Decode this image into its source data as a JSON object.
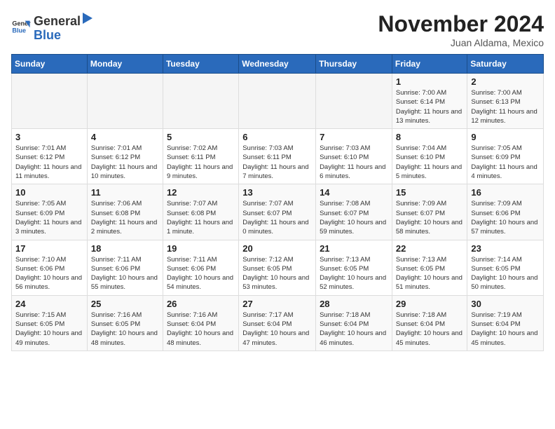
{
  "header": {
    "logo_general": "General",
    "logo_blue": "Blue",
    "month_title": "November 2024",
    "subtitle": "Juan Aldama, Mexico"
  },
  "weekdays": [
    "Sunday",
    "Monday",
    "Tuesday",
    "Wednesday",
    "Thursday",
    "Friday",
    "Saturday"
  ],
  "weeks": [
    [
      {
        "day": "",
        "info": ""
      },
      {
        "day": "",
        "info": ""
      },
      {
        "day": "",
        "info": ""
      },
      {
        "day": "",
        "info": ""
      },
      {
        "day": "",
        "info": ""
      },
      {
        "day": "1",
        "info": "Sunrise: 7:00 AM\nSunset: 6:14 PM\nDaylight: 11 hours and 13 minutes."
      },
      {
        "day": "2",
        "info": "Sunrise: 7:00 AM\nSunset: 6:13 PM\nDaylight: 11 hours and 12 minutes."
      }
    ],
    [
      {
        "day": "3",
        "info": "Sunrise: 7:01 AM\nSunset: 6:12 PM\nDaylight: 11 hours and 11 minutes."
      },
      {
        "day": "4",
        "info": "Sunrise: 7:01 AM\nSunset: 6:12 PM\nDaylight: 11 hours and 10 minutes."
      },
      {
        "day": "5",
        "info": "Sunrise: 7:02 AM\nSunset: 6:11 PM\nDaylight: 11 hours and 9 minutes."
      },
      {
        "day": "6",
        "info": "Sunrise: 7:03 AM\nSunset: 6:11 PM\nDaylight: 11 hours and 7 minutes."
      },
      {
        "day": "7",
        "info": "Sunrise: 7:03 AM\nSunset: 6:10 PM\nDaylight: 11 hours and 6 minutes."
      },
      {
        "day": "8",
        "info": "Sunrise: 7:04 AM\nSunset: 6:10 PM\nDaylight: 11 hours and 5 minutes."
      },
      {
        "day": "9",
        "info": "Sunrise: 7:05 AM\nSunset: 6:09 PM\nDaylight: 11 hours and 4 minutes."
      }
    ],
    [
      {
        "day": "10",
        "info": "Sunrise: 7:05 AM\nSunset: 6:09 PM\nDaylight: 11 hours and 3 minutes."
      },
      {
        "day": "11",
        "info": "Sunrise: 7:06 AM\nSunset: 6:08 PM\nDaylight: 11 hours and 2 minutes."
      },
      {
        "day": "12",
        "info": "Sunrise: 7:07 AM\nSunset: 6:08 PM\nDaylight: 11 hours and 1 minute."
      },
      {
        "day": "13",
        "info": "Sunrise: 7:07 AM\nSunset: 6:07 PM\nDaylight: 11 hours and 0 minutes."
      },
      {
        "day": "14",
        "info": "Sunrise: 7:08 AM\nSunset: 6:07 PM\nDaylight: 10 hours and 59 minutes."
      },
      {
        "day": "15",
        "info": "Sunrise: 7:09 AM\nSunset: 6:07 PM\nDaylight: 10 hours and 58 minutes."
      },
      {
        "day": "16",
        "info": "Sunrise: 7:09 AM\nSunset: 6:06 PM\nDaylight: 10 hours and 57 minutes."
      }
    ],
    [
      {
        "day": "17",
        "info": "Sunrise: 7:10 AM\nSunset: 6:06 PM\nDaylight: 10 hours and 56 minutes."
      },
      {
        "day": "18",
        "info": "Sunrise: 7:11 AM\nSunset: 6:06 PM\nDaylight: 10 hours and 55 minutes."
      },
      {
        "day": "19",
        "info": "Sunrise: 7:11 AM\nSunset: 6:06 PM\nDaylight: 10 hours and 54 minutes."
      },
      {
        "day": "20",
        "info": "Sunrise: 7:12 AM\nSunset: 6:05 PM\nDaylight: 10 hours and 53 minutes."
      },
      {
        "day": "21",
        "info": "Sunrise: 7:13 AM\nSunset: 6:05 PM\nDaylight: 10 hours and 52 minutes."
      },
      {
        "day": "22",
        "info": "Sunrise: 7:13 AM\nSunset: 6:05 PM\nDaylight: 10 hours and 51 minutes."
      },
      {
        "day": "23",
        "info": "Sunrise: 7:14 AM\nSunset: 6:05 PM\nDaylight: 10 hours and 50 minutes."
      }
    ],
    [
      {
        "day": "24",
        "info": "Sunrise: 7:15 AM\nSunset: 6:05 PM\nDaylight: 10 hours and 49 minutes."
      },
      {
        "day": "25",
        "info": "Sunrise: 7:16 AM\nSunset: 6:05 PM\nDaylight: 10 hours and 48 minutes."
      },
      {
        "day": "26",
        "info": "Sunrise: 7:16 AM\nSunset: 6:04 PM\nDaylight: 10 hours and 48 minutes."
      },
      {
        "day": "27",
        "info": "Sunrise: 7:17 AM\nSunset: 6:04 PM\nDaylight: 10 hours and 47 minutes."
      },
      {
        "day": "28",
        "info": "Sunrise: 7:18 AM\nSunset: 6:04 PM\nDaylight: 10 hours and 46 minutes."
      },
      {
        "day": "29",
        "info": "Sunrise: 7:18 AM\nSunset: 6:04 PM\nDaylight: 10 hours and 45 minutes."
      },
      {
        "day": "30",
        "info": "Sunrise: 7:19 AM\nSunset: 6:04 PM\nDaylight: 10 hours and 45 minutes."
      }
    ]
  ]
}
